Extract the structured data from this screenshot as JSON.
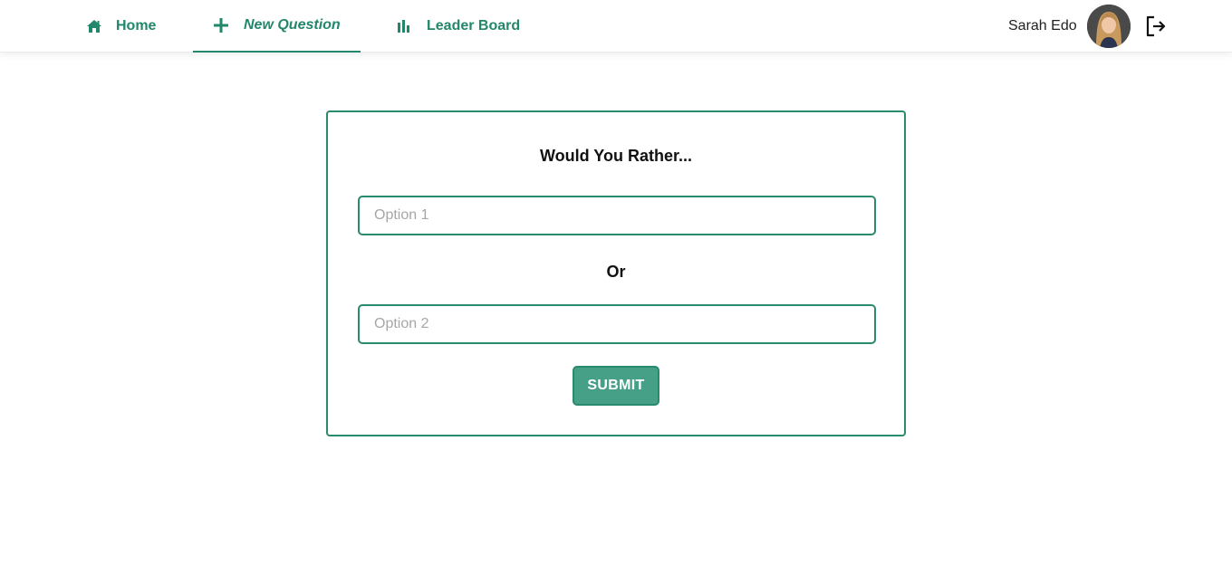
{
  "nav": {
    "home_label": "Home",
    "home_icon": "home-icon",
    "new_question_label": "New Question",
    "new_question_icon": "plus-icon",
    "leaderboard_label": "Leader Board",
    "leaderboard_icon": "bar-chart-icon",
    "active_tab": "New Question"
  },
  "user": {
    "name": "Sarah Edo",
    "logout_icon": "logout-icon"
  },
  "form": {
    "title": "Would You Rather...",
    "option1": {
      "placeholder": "Option 1",
      "value": ""
    },
    "separator": "Or",
    "option2": {
      "placeholder": "Option 2",
      "value": ""
    },
    "submit_label": "SUBMIT"
  },
  "colors": {
    "accent": "#22876b",
    "border": "#2a8a6d",
    "button_bg": "#46a088"
  }
}
